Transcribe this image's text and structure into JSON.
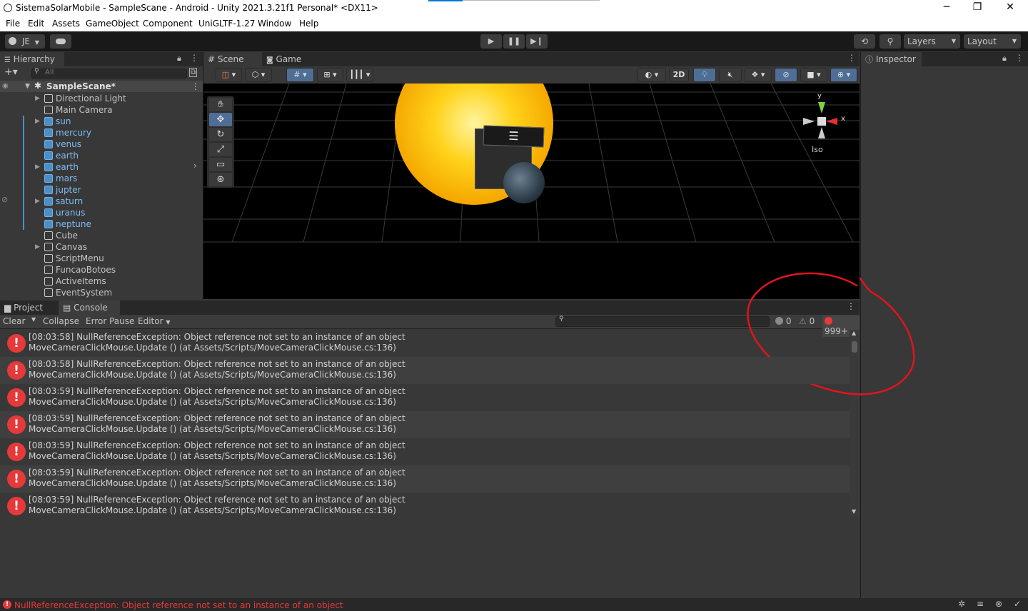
{
  "window": {
    "title": "SistemaSolarMobile - SampleScane - Android - Unity 2021.3.21f1 Personal* <DX11>",
    "minimize": "─",
    "maximize": "❐",
    "close": "✕"
  },
  "menu": [
    "File",
    "Edit",
    "Assets",
    "GameObject",
    "Component",
    "UniGLTF-1.27",
    "Window",
    "Help"
  ],
  "toolbar": {
    "account": "JE",
    "layers": "Layers",
    "layout": "Layout"
  },
  "hierarchy": {
    "tab": "Hierarchy",
    "search_placeholder": "All",
    "scene": "SampleScane*",
    "items": [
      {
        "label": "Directional Light",
        "prefab": false,
        "expandable": true
      },
      {
        "label": "Main Camera",
        "prefab": false,
        "expandable": false
      },
      {
        "label": "sun",
        "prefab": true,
        "expandable": true
      },
      {
        "label": "mercury",
        "prefab": true,
        "expandable": false
      },
      {
        "label": "venus",
        "prefab": true,
        "expandable": false
      },
      {
        "label": "earth",
        "prefab": true,
        "expandable": false
      },
      {
        "label": "earth",
        "prefab": true,
        "expandable": true
      },
      {
        "label": "mars",
        "prefab": true,
        "expandable": false
      },
      {
        "label": "jupter",
        "prefab": true,
        "expandable": false
      },
      {
        "label": "saturn",
        "prefab": true,
        "expandable": true
      },
      {
        "label": "uranus",
        "prefab": true,
        "expandable": false
      },
      {
        "label": "neptune",
        "prefab": true,
        "expandable": false
      },
      {
        "label": "Cube",
        "prefab": false,
        "expandable": false
      },
      {
        "label": "Canvas",
        "prefab": false,
        "expandable": true
      },
      {
        "label": "ScriptMenu",
        "prefab": false,
        "expandable": false
      },
      {
        "label": "FuncaoBotoes",
        "prefab": false,
        "expandable": false
      },
      {
        "label": "ActiveItems",
        "prefab": false,
        "expandable": false
      },
      {
        "label": "EventSystem",
        "prefab": false,
        "expandable": false
      }
    ]
  },
  "scene": {
    "tab_scene": "Scene",
    "tab_game": "Game",
    "btn_2d": "2D",
    "gizmo_y": "y",
    "gizmo_x": "x",
    "iso": "Iso"
  },
  "inspector": {
    "tab": "Inspector"
  },
  "console": {
    "tab_project": "Project",
    "tab_console": "Console",
    "clear": "Clear",
    "collapse": "Collapse",
    "error_pause": "Error Pause",
    "editor": "Editor",
    "count_info": "0",
    "count_warn": "0",
    "count_error": "999+",
    "entries": [
      {
        "line1": "[08:03:58] NullReferenceException: Object reference not set to an instance of an object",
        "line2": "MoveCameraClickMouse.Update () (at Assets/Scripts/MoveCameraClickMouse.cs:136)"
      },
      {
        "line1": "[08:03:58] NullReferenceException: Object reference not set to an instance of an object",
        "line2": "MoveCameraClickMouse.Update () (at Assets/Scripts/MoveCameraClickMouse.cs:136)"
      },
      {
        "line1": "[08:03:59] NullReferenceException: Object reference not set to an instance of an object",
        "line2": "MoveCameraClickMouse.Update () (at Assets/Scripts/MoveCameraClickMouse.cs:136)"
      },
      {
        "line1": "[08:03:59] NullReferenceException: Object reference not set to an instance of an object",
        "line2": "MoveCameraClickMouse.Update () (at Assets/Scripts/MoveCameraClickMouse.cs:136)"
      },
      {
        "line1": "[08:03:59] NullReferenceException: Object reference not set to an instance of an object",
        "line2": "MoveCameraClickMouse.Update () (at Assets/Scripts/MoveCameraClickMouse.cs:136)"
      },
      {
        "line1": "[08:03:59] NullReferenceException: Object reference not set to an instance of an object",
        "line2": "MoveCameraClickMouse.Update () (at Assets/Scripts/MoveCameraClickMouse.cs:136)"
      },
      {
        "line1": "[08:03:59] NullReferenceException: Object reference not set to an instance of an object",
        "line2": "MoveCameraClickMouse.Update () (at Assets/Scripts/MoveCameraClickMouse.cs:136)"
      }
    ]
  },
  "status": {
    "message": "NullReferenceException: Object reference not set to an instance of an object"
  },
  "colors": {
    "error": "#e6393a",
    "annotation": "#e0141e",
    "accent": "#3a79bb"
  }
}
